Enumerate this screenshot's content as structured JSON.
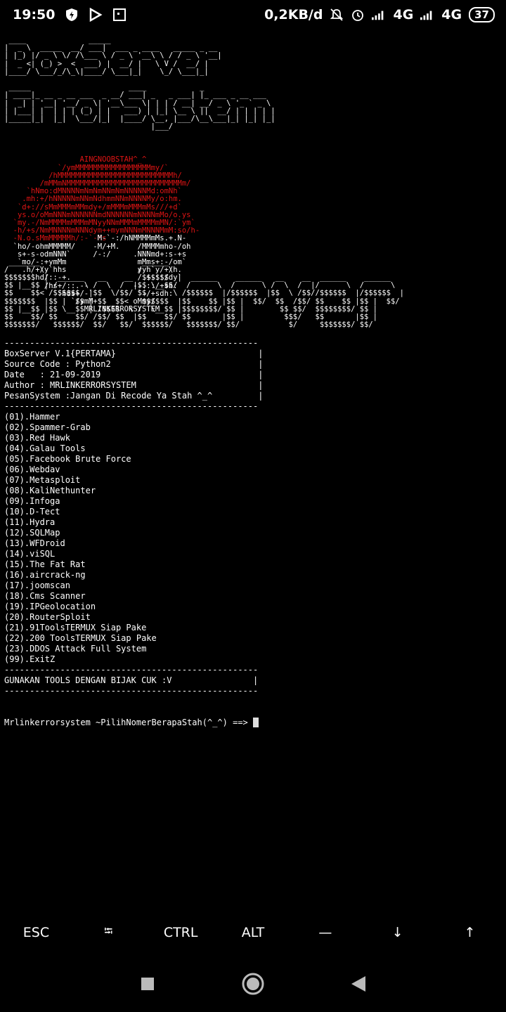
{
  "status_bar": {
    "time": "19:50",
    "net_speed": "0,2KB/d",
    "signal1": "4G",
    "signal2": "4G",
    "battery": "37",
    "icons": [
      "shield-bolt-icon",
      "play-icon",
      "notification-square-icon",
      "mute-icon",
      "alarm-icon",
      "signal-icon",
      "signal-icon-2"
    ]
  },
  "terminal": {
    "banner_text": " ____              _____\n|  _ \\  _____  __/ ___|  ___ _ ____   _____ _ __\n| |_) |/ _ \\ \\/ /\\___ \\ / _ \\ '__\\ \\ / / _ \\ '__|\n|  _ <| (_) >  <  ___) |  __/ |   \\ V /  __/ |\n|____/ \\___/_/\\_\\|____/ \\___|_|    \\_/ \\___|_|\n\n _____                      ____            _\n| ____|_ __ _ __ ___  _ __/ ___| _   _ ___| |_ ___ _ __ ___\n|  _| | '__| '__/ _ \\| '__\\___ \\| | | / __| __/ _ \\ '_ ` _ \\\n| |___| |  | | | (_) | |   ___) | |_| \\__ \\ ||  __/ | | | | |\n|_____|_|  |_|  \\___/|_|  |____/ \\__, |___/\\__\\___|_| |_| |_|\n                                 |___/",
    "skull_red": "                 AINGNOOBSTAH^_^\n            `/ymMMMMMMMMMMMMMMMMMmy/`\n          /hMMMMMMMMMMMMMMMMMMMMMMMMMMh/\n        /mMMmNMMMMMMMMMMMMMMMMMMMMMMMMMMm/\n     `hNmo:dMNNNNmNmNmNNmNmNNNNNMd:omNh`\n    .mh:+/hNNNNNmNNmNdhmmNNmNNNNMy/o:hm.\n   `d+://sMmMMMmMMmdy+/mMMMmMMMmMs///+d`\n   ys.o/oMmNNNmNNNNNNmdNNNNNNmNNNNmMo/o.ys\n  `my.-/NmMMMMmMMMmMNyyNNmMMMmMMMMmMN/:`ym`\n  -h/+s/NmMNNNNmNNNdym++mymNNNmMNNNMmM:so/h-\n  -N.o.sMmMMMMMh/:-`-Ms",
    "skull_white": "                                                                 \n\n\n\n\n\n\n\n\n\n                     M-`-:/hNMMMMmMs.+.N-\n  `ho/-ohmMMMMM/    -M/+M.    /MMMMmho-/oh\n   s+-s-odmNNN`     /-:/     .NNNmd+:s-+s\n   `mo/-:+ymMm                mMms+:-/om`\n    .h/+/y`hhs                yyh`y/+/h.\n      `hd/::-+.                .+-::/dy`\n         /hs+/::.--          --.::/+sh:\n            :hds+/-`          `-/+sdh:\n               `/ymM+        oMmy/\n                  MRLINKERRORSYSTEM",
    "banner2_text": " _______                       ______\n/       \\                     /      \\\n$$$$$$$  |  ______   __    __ /$$$$$$  |  ______    ______   __    __  ______    ______\n$$ |__$$ | /      \\ /  \\  /  |$$ \\__$$/  /      \\  /      \\ /  \\  /  |/      \\  /      \\\n$$    $$< /$$$$$$  |$$  \\/$$/ $$      \\ /$$$$$$  |/$$$$$$  |$$  \\ /$$//$$$$$$  |/$$$$$$  |\n$$$$$$$  |$$ |  $$ | $$  $$<   $$$$$$  |$$    $$ |$$ |  $$/  $$  /$$/ $$    $$ |$$ |  $$/\n$$ |__$$ |$$ \\__$$ | /$$$$  \\ /  \\__$$ |$$$$$$$$/ $$ |        $$ $$/  $$$$$$$$/ $$ |\n$$    $$/ $$    $$/ /$$/ $$  |$$    $$/ $$       |$$ |         $$$/   $$       |$$ |\n$$$$$$$/   $$$$$$/  $$/   $$/  $$$$$$/   $$$$$$$/ $$/           $/     $$$$$$$/ $$/",
    "info_text": "--------------------------------------------------\nBoxServer V.1{PERTAMA}                            |\nSource Code : Python2                             |\nDate   : 21-09-2019                               |\nAuthor : MRLINKERRORSYSTEM                        |\nPesanSystem :Jangan Di Recode Ya Stah ^_^         |\n--------------------------------------------------",
    "menu_items": [
      "(01).Hammer",
      "(02).Spammer-Grab",
      "(03).Red Hawk",
      "(04).Galau Tools",
      "(05).Facebook Brute Force",
      "(06).Webdav",
      "(07).Metasploit",
      "(08).KaliNethunter",
      "(09).Infoga",
      "(10).D-Tect",
      "(11).Hydra",
      "(12).SQLMap",
      "(13).WFDroid",
      "(14).viSQL",
      "(15).The Fat Rat",
      "(16).aircrack-ng",
      "(17).joomscan",
      "(18).Cms Scanner",
      "(19).IPGeolocation",
      "(20).RouterSploit",
      "(21).91ToolsTERMUX Siap Pake",
      "(22).200 ToolsTERMUX Siap Pake",
      "(23).DDOS Attack Full System",
      "(99).ExitZ"
    ],
    "footer_text": "--------------------------------------------------\nGUNAKAN TOOLS DENGAN BIJAK CUK :V                |\n--------------------------------------------------",
    "prompt": "Mrlinkerrorsystem ~PilihNomerBerapaStah(^_^) ==> "
  },
  "extra_keys": {
    "esc": "ESC",
    "tab": "⭾",
    "ctrl": "CTRL",
    "alt": "ALT",
    "dash": "—",
    "down": "↓",
    "up": "↑"
  },
  "colors": {
    "background": "#000000",
    "accent_red": "#e01414",
    "text": "#ffffff"
  }
}
